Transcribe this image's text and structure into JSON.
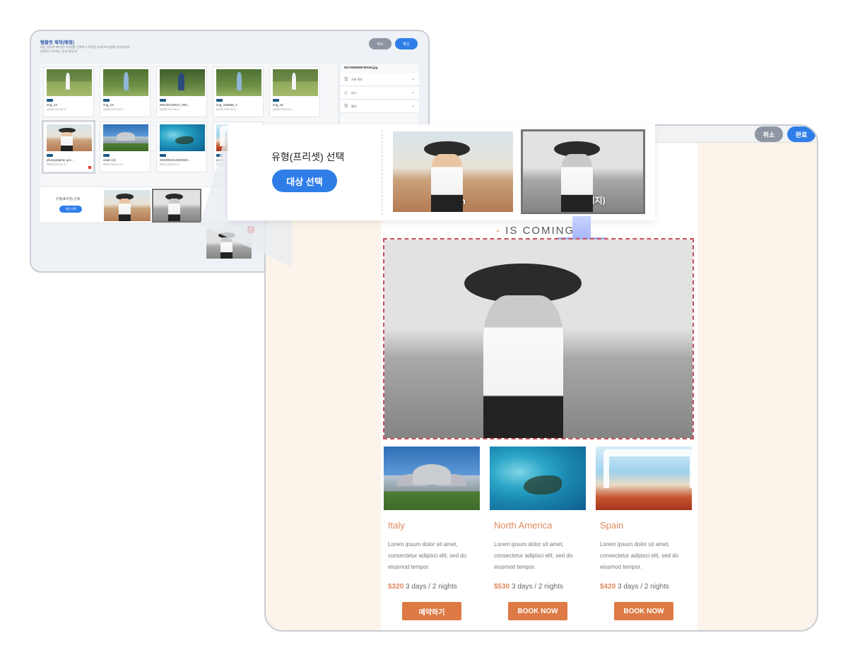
{
  "back_window": {
    "title": "템플릿 제작(배정)",
    "description_line1": "대상 영역에 배치할 이미지를 선택하고 적용할 효과(프리셋)를 지정하세요.",
    "description_line2": "(완료된 이미지는 완성 편집기)",
    "cancel_label": "취소",
    "confirm_label": "확인",
    "thumbnails": [
      {
        "name": "img_13",
        "meta": "남연희 2023.06.01",
        "badge": "PNG",
        "kind": "golf"
      },
      {
        "name": "img_15",
        "meta": "남연희 2023.06.01",
        "badge": "PNG",
        "kind": "golf2"
      },
      {
        "name": "IMG20130914_000...",
        "meta": "남연희 2023.06.01",
        "badge": "JPG",
        "kind": "golf3"
      },
      {
        "name": "img_166869_1",
        "meta": "남연희 2023.06.01",
        "badge": "PNG",
        "kind": "golf2"
      },
      {
        "name": "img_16",
        "meta": "남연희 2023.06.01",
        "badge": "PNG",
        "kind": "golf"
      },
      {
        "name": "photographer gcc...",
        "meta": "박민희 2023.01.21",
        "badge": "JPG",
        "kind": "woman"
      },
      {
        "name": "asian (2)",
        "meta": "박민희 2023.01.21",
        "badge": "JPG",
        "kind": "mosque"
      },
      {
        "name": "2022052314303032...",
        "meta": "박민희 2023.01.21",
        "badge": "JPG",
        "kind": "sea"
      },
      {
        "name": "asian...",
        "meta": "박민희 2023.01.21",
        "badge": "JPG",
        "kind": "beach"
      }
    ],
    "side_panel": {
      "file_name": "5fa7058059876015d.jpg",
      "rows": [
        {
          "icon": "☰",
          "label": "기본 정보"
        },
        {
          "icon": "◇",
          "label": "태그"
        },
        {
          "icon": "☰",
          "label": "필터"
        }
      ]
    },
    "preset_strip": {
      "label": "유형(프리셋) 선택",
      "button": "대상 선택",
      "presets": [
        "Origin",
        "흑백(데이지)"
      ]
    }
  },
  "front_window": {
    "cancel_label": "취소",
    "done_label": "완료",
    "callout": {
      "title": "유형(프리셋) 선택",
      "button": "대상 선택",
      "presets": [
        {
          "label": "Origin",
          "selected": false
        },
        {
          "label": "흑백(데이지)",
          "selected": true
        }
      ]
    },
    "heading": "IS COMING",
    "destinations": [
      {
        "title": "Italy",
        "body": "Lorem ipsum dolor sit amet, consectetur adipisci elit, sed do eiusmod tempor.",
        "price": "$320",
        "duration": "3 days / 2 nights",
        "button": "예약하기",
        "kind": "mosque"
      },
      {
        "title": "North America",
        "body": "Lorem ipsum dolor sit amet, consectetur adipisci elit, sed do eiusmod tempor.",
        "price": "$530",
        "duration": "3 days / 2 nights",
        "button": "BOOK NOW",
        "kind": "sea"
      },
      {
        "title": "Spain",
        "body": "Lorem ipsum dolor sit amet, consectetur adipisci elit, sed do eiusmod tempor.",
        "price": "$420",
        "duration": "3 days / 2 nights",
        "button": "BOOK NOW",
        "kind": "beach"
      }
    ]
  },
  "colors": {
    "accent_blue": "#2f7ee8",
    "accent_orange": "#dd7a45",
    "page_cream": "#fcf4ea",
    "dashed_selection": "#c8505a"
  }
}
